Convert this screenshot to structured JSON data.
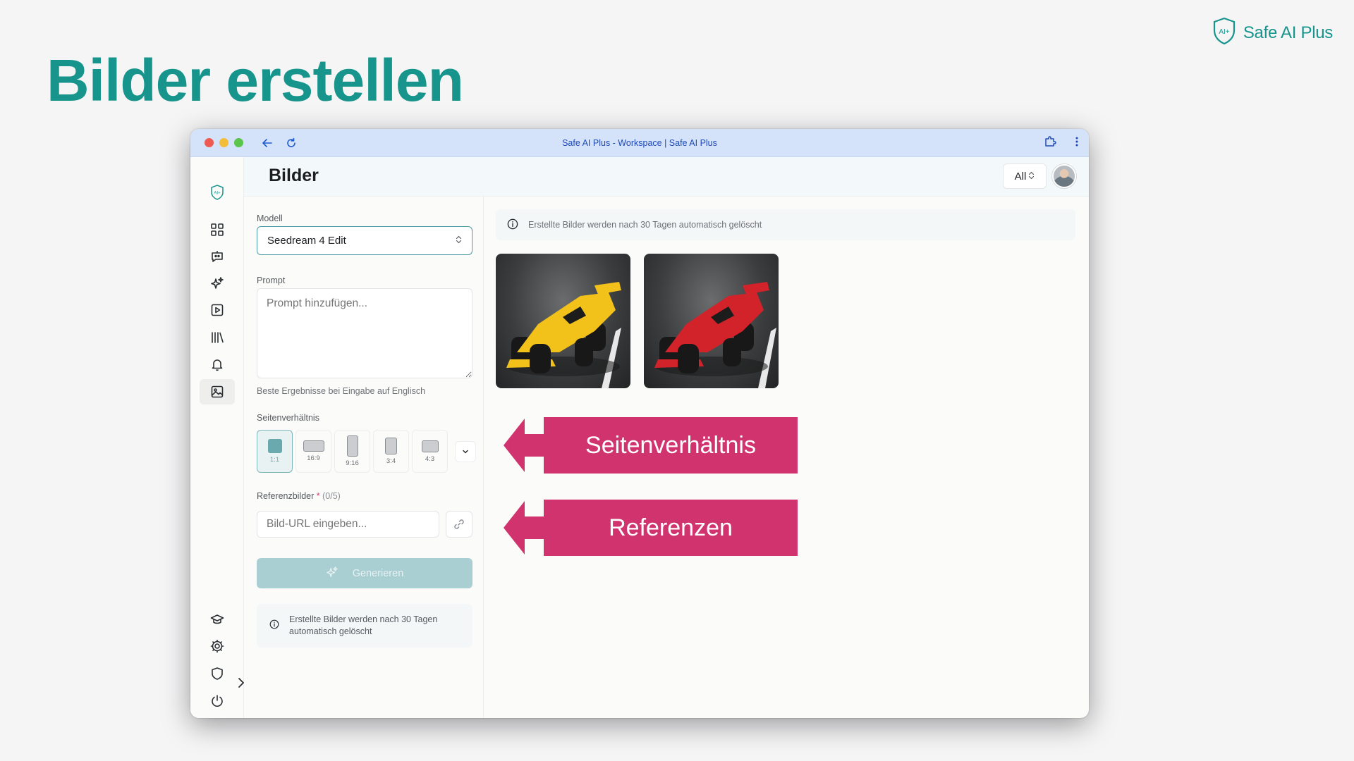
{
  "slide": {
    "title": "Bilder erstellen"
  },
  "brand": {
    "name": "Safe AI Plus",
    "logo_text": "AI+"
  },
  "window": {
    "title": "Safe AI Plus - Workspace | Safe AI Plus"
  },
  "header": {
    "title": "Bilder",
    "filter_value": "All"
  },
  "sidebar": {
    "items": [
      {
        "name": "dashboard",
        "icon": "grid-icon"
      },
      {
        "name": "chat",
        "icon": "chat-bot-icon"
      },
      {
        "name": "assistants",
        "icon": "sparkles-icon"
      },
      {
        "name": "videos",
        "icon": "play-square-icon"
      },
      {
        "name": "library",
        "icon": "library-icon"
      },
      {
        "name": "notifications",
        "icon": "bell-icon"
      },
      {
        "name": "images",
        "icon": "image-icon",
        "active": true
      },
      {
        "name": "academy",
        "icon": "graduation-cap-icon"
      },
      {
        "name": "settings",
        "icon": "gear-icon"
      },
      {
        "name": "security",
        "icon": "shield-icon"
      },
      {
        "name": "logout",
        "icon": "power-icon"
      }
    ]
  },
  "form": {
    "model_label": "Modell",
    "model_value": "Seedream 4 Edit",
    "prompt_label": "Prompt",
    "prompt_placeholder": "Prompt hinzufügen...",
    "prompt_hint": "Beste Ergebnisse bei Eingabe auf Englisch",
    "ratio_label": "Seitenverhältnis",
    "ratios": [
      "1:1",
      "16:9",
      "9:16",
      "3:4",
      "4:3"
    ],
    "selected_ratio": "1:1",
    "ref_label": "Referenzbilder",
    "ref_required": "*",
    "ref_count": "(0/5)",
    "ref_placeholder": "Bild-URL eingeben...",
    "generate_label": "Generieren",
    "notice": "Erstellte Bilder werden nach 30 Tagen automatisch gelöscht"
  },
  "gallery": {
    "notice": "Erstellte Bilder werden nach 30 Tagen automatisch gelöscht",
    "images": [
      {
        "name": "formula-car-yellow",
        "body_color": "#f2c21b",
        "accent_color": "#1c1c1c"
      },
      {
        "name": "formula-car-red",
        "body_color": "#d2232a",
        "accent_color": "#1c1c1c"
      }
    ]
  },
  "callouts": [
    {
      "label": "Seitenverhältnis",
      "color": "#d1336f"
    },
    {
      "label": "Referenzen",
      "color": "#d1336f"
    }
  ],
  "colors": {
    "brand": "#17958c",
    "accent": "#4e9aa4",
    "callout": "#d1336f"
  }
}
